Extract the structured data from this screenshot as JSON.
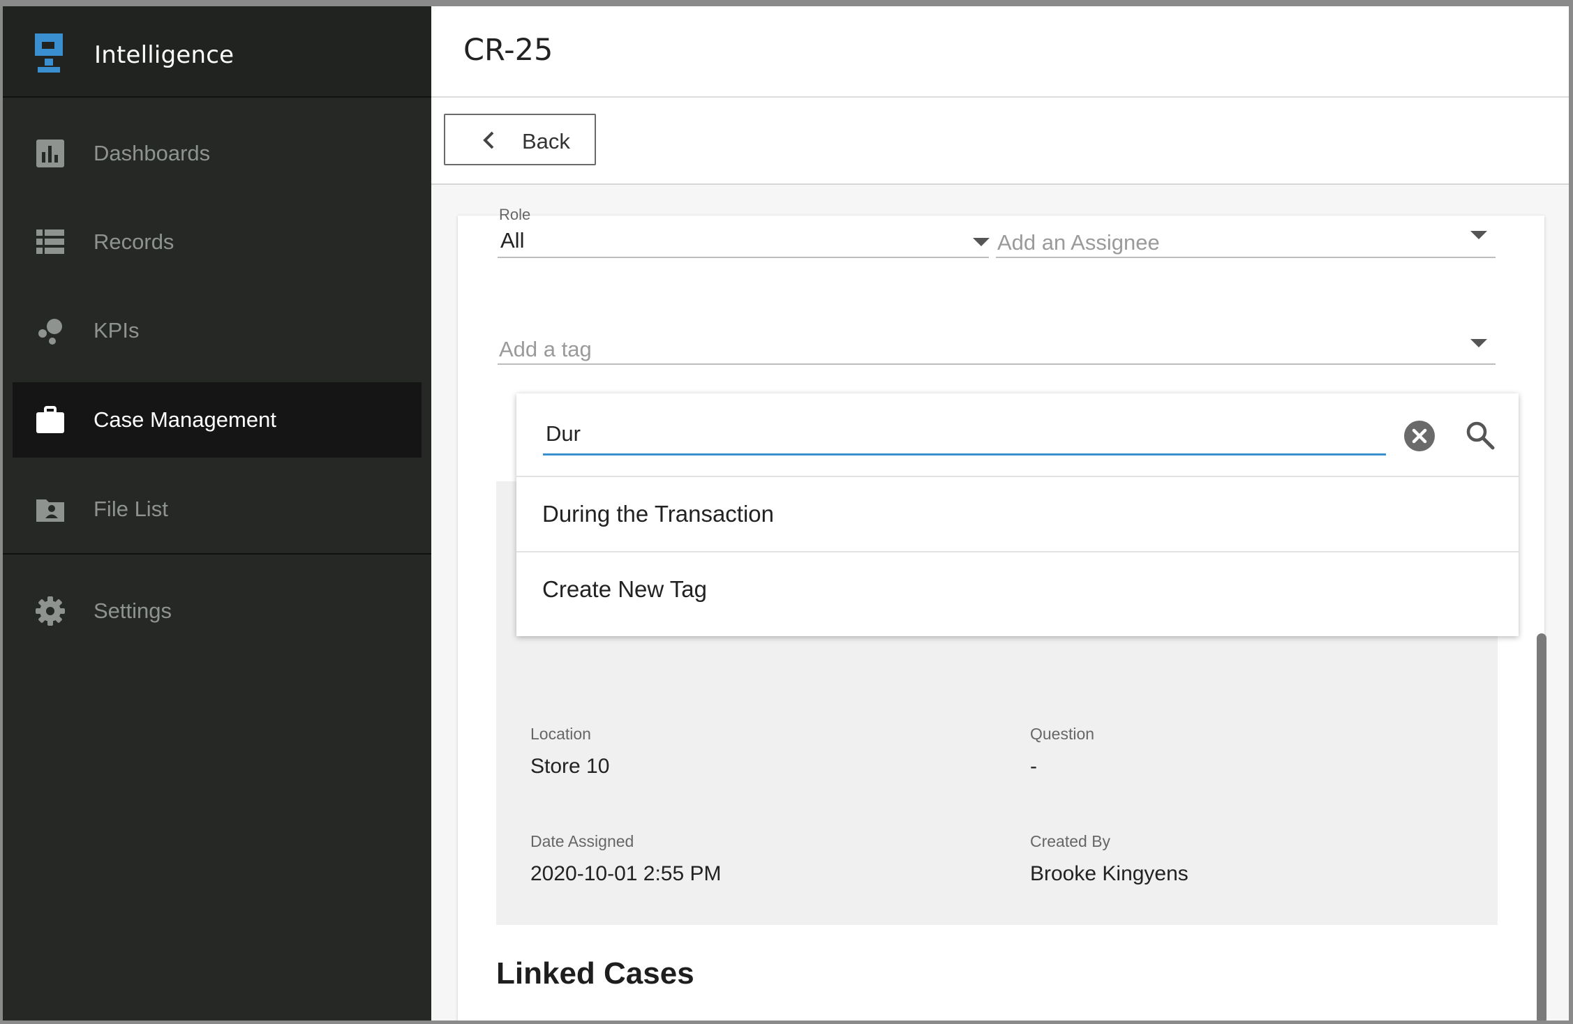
{
  "app": {
    "name": "Intelligence",
    "logo_icon": "intelligence-logo-icon",
    "accent": "#3a8fd0"
  },
  "sidebar": {
    "items": [
      {
        "label": "Dashboards",
        "icon": "bar-chart-icon"
      },
      {
        "label": "Records",
        "icon": "list-icon"
      },
      {
        "label": "KPIs",
        "icon": "bubbles-icon"
      },
      {
        "label": "Case Management",
        "icon": "briefcase-icon",
        "active": true
      },
      {
        "label": "File List",
        "icon": "folder-user-icon"
      },
      {
        "label": "Settings",
        "icon": "gear-icon"
      }
    ]
  },
  "header": {
    "title": "CR-25"
  },
  "toolbar": {
    "back_label": "Back"
  },
  "form": {
    "role_label": "Role",
    "role_value": "All",
    "assignee_placeholder": "Add an Assignee",
    "tag_placeholder": "Add a tag"
  },
  "tag_dropdown": {
    "search_value": "Dur",
    "options": [
      "During the Transaction",
      "Create New Tag"
    ]
  },
  "details": {
    "location_label": "Location",
    "location_value": "Store 10",
    "question_label": "Question",
    "question_value": "-",
    "date_assigned_label": "Date Assigned",
    "date_assigned_value": "2020-10-01 2:55 PM",
    "created_by_label": "Created By",
    "created_by_value": "Brooke Kingyens"
  },
  "linked_cases": {
    "title": "Linked Cases"
  }
}
